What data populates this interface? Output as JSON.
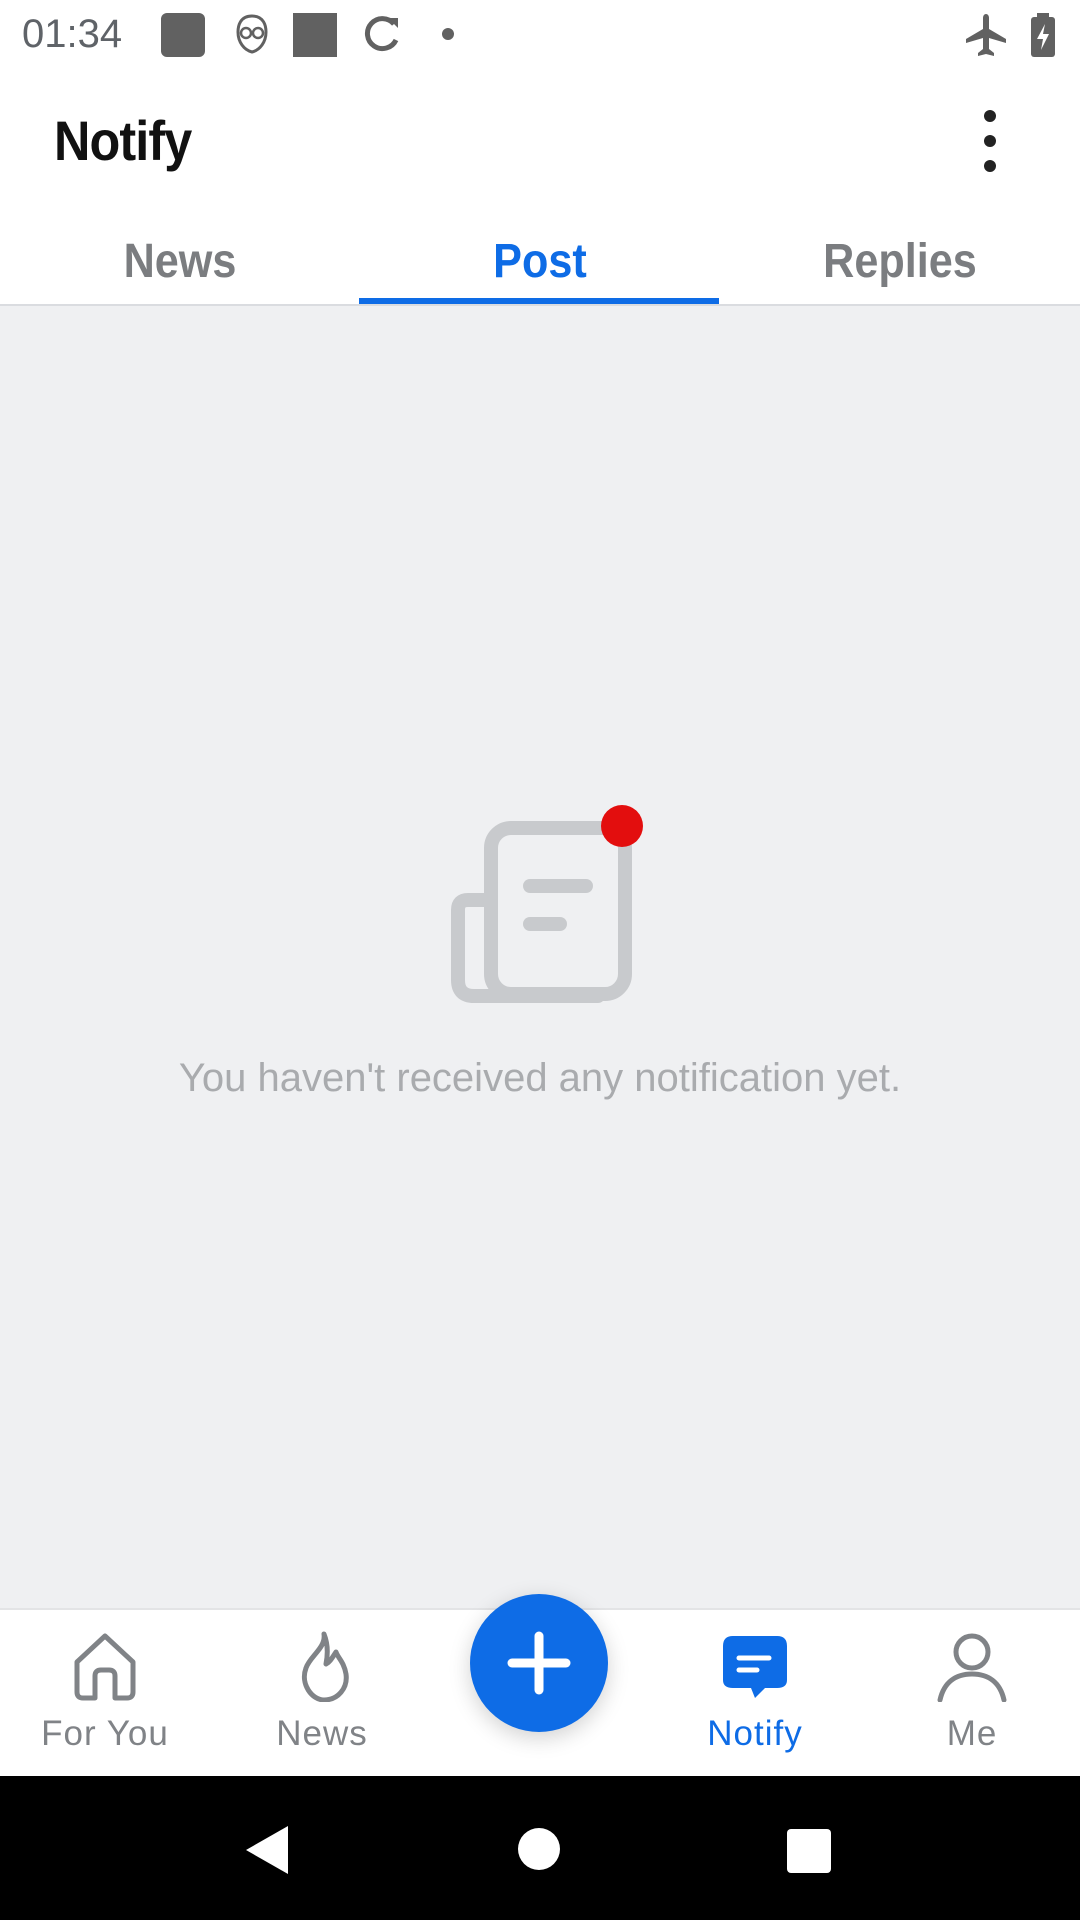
{
  "status_bar": {
    "time": "01:34",
    "icons": [
      "notification-square-icon",
      "robot-face-icon",
      "notification-square-icon",
      "sync-icon",
      "dot-icon"
    ],
    "right_icons": [
      "airplane-mode-icon",
      "battery-charging-icon"
    ]
  },
  "app_bar": {
    "title": "Notify",
    "overflow_icon": "more-vert-icon"
  },
  "tabs": [
    {
      "label": "News",
      "active": false
    },
    {
      "label": "Post",
      "active": true
    },
    {
      "label": "Replies",
      "active": false
    }
  ],
  "empty_state": {
    "illustration": "newspaper-notification-icon",
    "message": "You haven't received any notification yet."
  },
  "bottom_nav": {
    "items": [
      {
        "label": "For You",
        "icon": "home-icon",
        "active": false
      },
      {
        "label": "News",
        "icon": "flame-icon",
        "active": false
      },
      {
        "label": "Notify",
        "icon": "chat-bubble-icon",
        "active": true
      },
      {
        "label": "Me",
        "icon": "person-icon",
        "active": false
      }
    ],
    "fab_icon": "plus-icon"
  },
  "system_nav": [
    "back-icon",
    "home-circle-icon",
    "recents-icon"
  ],
  "colors": {
    "accent": "#0e6ce6",
    "badge": "#e30e0e",
    "background": "#eff0f2",
    "illustration": "#c8cacd"
  }
}
